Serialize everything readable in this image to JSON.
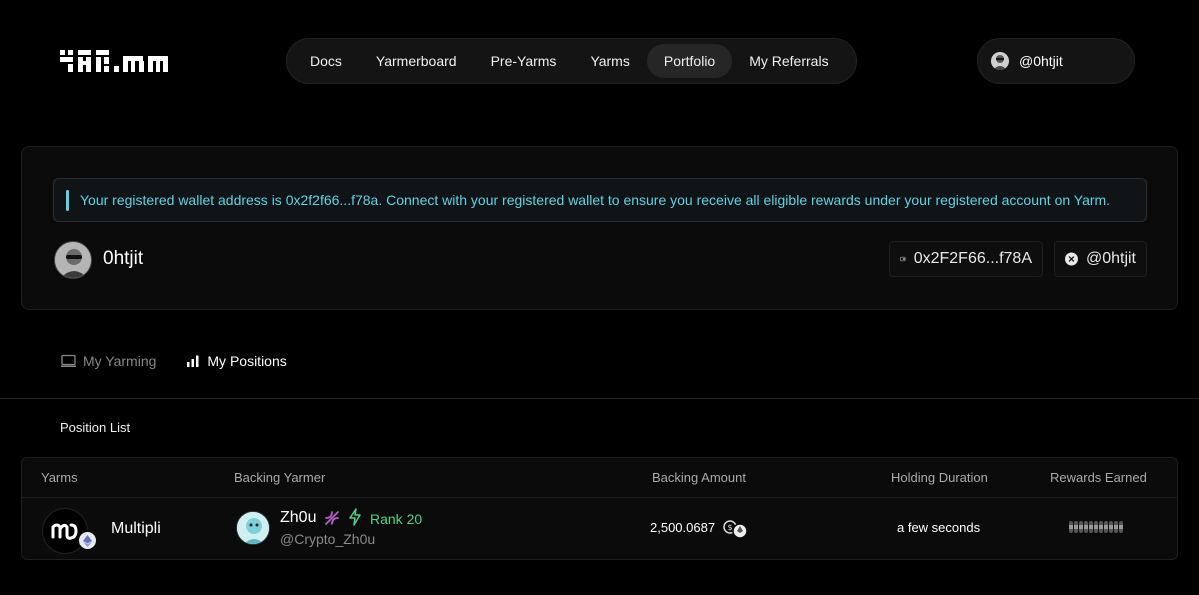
{
  "brand": {
    "logo_text": "yarm"
  },
  "nav": {
    "items": [
      {
        "label": "Docs",
        "active": false
      },
      {
        "label": "Yarmerboard",
        "active": false
      },
      {
        "label": "Pre-Yarms",
        "active": false
      },
      {
        "label": "Yarms",
        "active": false
      },
      {
        "label": "Portfolio",
        "active": true
      },
      {
        "label": "My Referrals",
        "active": false
      }
    ]
  },
  "user": {
    "handle": "@0htjit"
  },
  "profile": {
    "notice": "Your registered wallet address is 0x2f2f66...f78a. Connect with your registered wallet to ensure you receive all eligible rewards under your registered account on Yarm.",
    "name": "0htjit",
    "wallet": "0x2F2F66...f78A",
    "twitter": "@0htjit"
  },
  "tabs": {
    "my_yarming": "My Yarming",
    "my_positions": "My Positions"
  },
  "positions": {
    "title": "Position List",
    "columns": [
      "Yarms",
      "Backing Yarmer",
      "Backing Amount",
      "Holding Duration",
      "Rewards Earned"
    ],
    "rows": [
      {
        "yarm": "Multipli",
        "yarmer_name": "Zh0u",
        "rank": "Rank 20",
        "yarmer_handle": "@Crypto_Zh0u",
        "amount": "2,500.0687",
        "duration": "a few seconds",
        "rewards_hidden": true
      }
    ]
  },
  "colors": {
    "accent": "#5fd3e6",
    "rank": "#4fd38b",
    "background": "#000000"
  }
}
